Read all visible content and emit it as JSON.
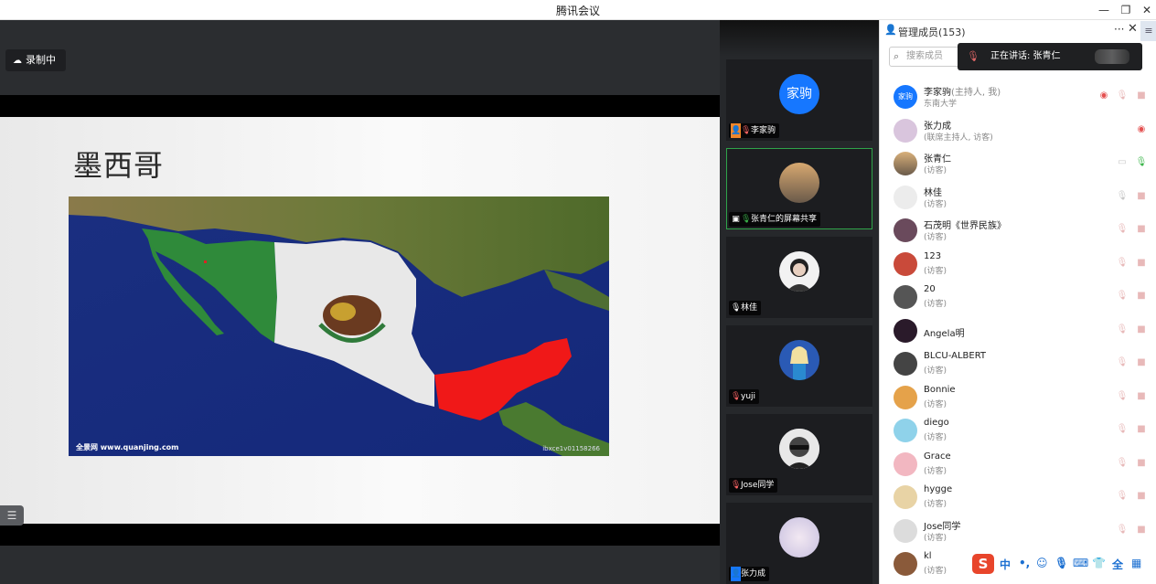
{
  "window": {
    "title": "腾讯会议",
    "minimize": "—",
    "restore": "❐",
    "close": "✕"
  },
  "recording": {
    "label": "录制中",
    "icon": "cloud-icon"
  },
  "slide": {
    "title": "墨西哥",
    "watermark_left": "全景网 www.quanjing.com",
    "watermark_right": "ibxce1v01158266"
  },
  "gallery": [
    {
      "avatar_text": "家驹",
      "name": "李家驹",
      "mic": "muted",
      "badge": "host-avatar-icon"
    },
    {
      "avatar_text": "",
      "name": "张青仁的屏幕共享",
      "mic": "on",
      "badge": "screen-share-icon",
      "active": true
    },
    {
      "avatar_text": "",
      "name": "林佳",
      "mic": "on"
    },
    {
      "avatar_text": "",
      "name": "yuji",
      "mic": "muted"
    },
    {
      "avatar_text": "",
      "name": "Jose同学",
      "mic": "muted"
    },
    {
      "avatar_text": "",
      "name": "张力成",
      "mic": "",
      "badge": "user-icon"
    }
  ],
  "panel": {
    "title": "管理成员(153)",
    "more": "···",
    "close": "✕",
    "menu": "≡",
    "search_placeholder": "搜索成员",
    "speaking_label": "正在讲话: 张青仁",
    "accent": "#1b6fd1"
  },
  "members": [
    {
      "name": "李家驹",
      "tag": "(主持人, 我)",
      "role": "东南大学",
      "avatar_text": "家驹",
      "color": "#1677ff"
    },
    {
      "name": "张力成",
      "tag": "",
      "role": "(联席主持人, 访客)",
      "avatar_text": "",
      "color": "#d9c5dd"
    },
    {
      "name": "张青仁",
      "tag": "",
      "role": "(访客)",
      "avatar_text": "",
      "color": "#a88c6a"
    },
    {
      "name": "林佳",
      "tag": "",
      "role": "(访客)",
      "avatar_text": "",
      "color": "#ececec"
    },
    {
      "name": "石茂明《世界民族》",
      "tag": "",
      "role": "(访客)",
      "avatar_text": "",
      "color": "#6a4a5c"
    },
    {
      "name": "123",
      "tag": "",
      "role": "(访客)",
      "avatar_text": "",
      "color": "#c94a3a"
    },
    {
      "name": "20",
      "tag": "",
      "role": "(访客)",
      "avatar_text": "",
      "color": "#555"
    },
    {
      "name": "Angela明",
      "tag": "",
      "role": "",
      "avatar_text": "",
      "color": "#2a1a2a"
    },
    {
      "name": "BLCU-ALBERT",
      "tag": "",
      "role": "(访客)",
      "avatar_text": "",
      "color": "#444"
    },
    {
      "name": "Bonnie",
      "tag": "",
      "role": "(访客)",
      "avatar_text": "",
      "color": "#e5a24a"
    },
    {
      "name": "diego",
      "tag": "",
      "role": "(访客)",
      "avatar_text": "",
      "color": "#8fd2ea"
    },
    {
      "name": "Grace",
      "tag": "",
      "role": "(访客)",
      "avatar_text": "",
      "color": "#f2b7c1"
    },
    {
      "name": "hygge",
      "tag": "",
      "role": "(访客)",
      "avatar_text": "",
      "color": "#e8d3a5"
    },
    {
      "name": "Jose同学",
      "tag": "",
      "role": "(访客)",
      "avatar_text": "",
      "color": "#dcdcdc"
    },
    {
      "name": "kl",
      "tag": "",
      "role": "(访客)",
      "avatar_text": "",
      "color": "#8a5a3a"
    }
  ],
  "ime": {
    "logo": "S",
    "mode": "中",
    "punct": "•,",
    "emoji": "☺",
    "voice": "🎙",
    "keyboard": "⌨",
    "skin": "👕",
    "full": "全",
    "tools": "▦"
  }
}
